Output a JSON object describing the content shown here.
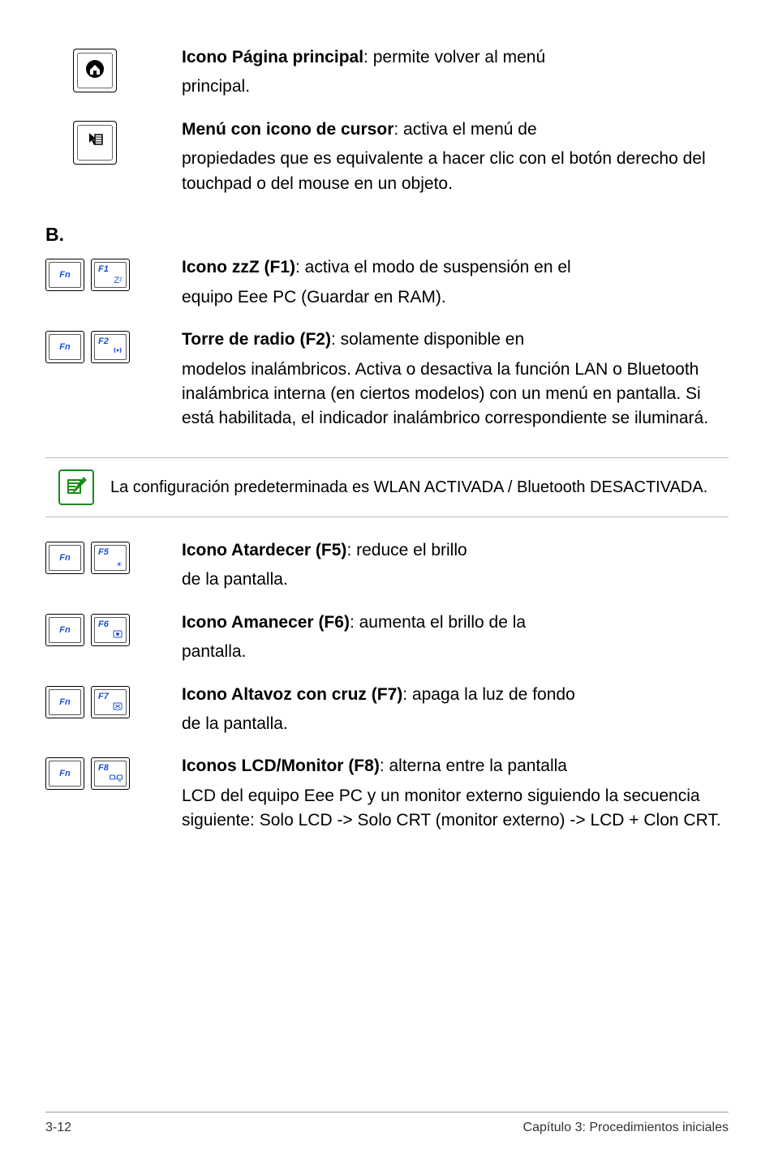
{
  "items": {
    "home": {
      "title": "Icono Página principal",
      "desc": ": permite volver al menú",
      "cont": "principal."
    },
    "menu": {
      "title": "Menú con icono de cursor",
      "desc": ": activa el menú de",
      "cont": "propiedades que es equivalente a hacer clic con el botón derecho del touchpad o del mouse en un objeto."
    },
    "section_b": "B.",
    "f1": {
      "title": "Icono zzZ (F1)",
      "desc": ": activa el modo de suspensión en el",
      "cont": "equipo Eee PC  (Guardar en RAM)."
    },
    "f2": {
      "title": "Torre de radio (F2)",
      "desc": ": solamente disponible en",
      "cont": "modelos inalámbricos. Activa o desactiva la función LAN o Bluetooth inalámbrica interna (en ciertos modelos) con un menú en pantalla. Si está habilitada, el indicador inalámbrico correspondiente se iluminará."
    },
    "note": "La configuración predeterminada es WLAN ACTIVADA / Bluetooth DESACTIVADA.",
    "f5": {
      "title": "Icono Atardecer (F5)",
      "desc": ": reduce el brillo",
      "cont": "de la pantalla."
    },
    "f6": {
      "title": "Icono Amanecer (F6)",
      "desc": ": aumenta el brillo de la",
      "cont": "pantalla."
    },
    "f7": {
      "title": "Icono Altavoz con cruz (F7)",
      "desc": ": apaga la luz de fondo",
      "cont": "de la pantalla."
    },
    "f8": {
      "title": "Iconos LCD/Monitor (F8)",
      "desc": ": alterna entre la pantalla",
      "cont": "LCD del equipo Eee PC y un monitor externo siguiendo la secuencia siguiente: Solo LCD -> Solo CRT (monitor externo) -> LCD + Clon CRT."
    }
  },
  "keys": {
    "fn": "Fn",
    "f1": "F1",
    "f1_sym": "Zᶻ",
    "f2": "F2",
    "f5": "F5",
    "f5_sym": "☀",
    "f6": "F6",
    "f7": "F7",
    "f7_sym": "⊠",
    "f8": "F8",
    "f8_sym": "◻/▢"
  },
  "footer": {
    "left": "3-12",
    "right": "Capítulo 3: Procedimientos iniciales"
  }
}
